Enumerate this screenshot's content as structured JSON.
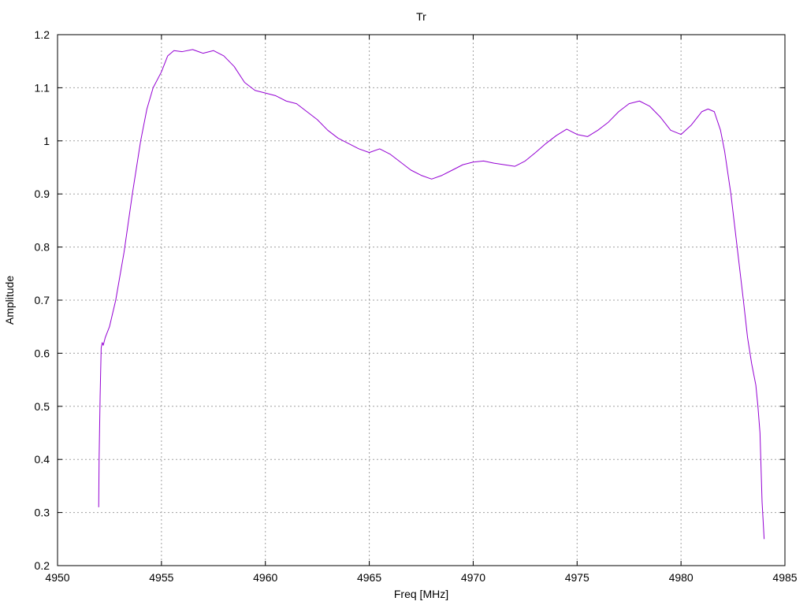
{
  "chart_data": {
    "type": "line",
    "title": "Tr",
    "xlabel": "Freq [MHz]",
    "ylabel": "Amplitude",
    "xlim": [
      4950,
      4985
    ],
    "ylim": [
      0.2,
      1.2
    ],
    "xticks": [
      4950,
      4955,
      4960,
      4965,
      4970,
      4975,
      4980,
      4985
    ],
    "yticks": [
      0.2,
      0.3,
      0.4,
      0.5,
      0.6,
      0.7,
      0.8,
      0.9,
      1,
      1.1,
      1.2
    ],
    "ytick_labels": [
      "0.2",
      "0.3",
      "0.4",
      "0.5",
      "0.6",
      "0.7",
      "0.8",
      "0.9",
      "1",
      "1.1",
      "1.2"
    ],
    "grid": true,
    "series": [
      {
        "color": "#9400d3",
        "x": [
          4951.98,
          4952.0,
          4952.05,
          4952.1,
          4952.15,
          4952.2,
          4952.3,
          4952.5,
          4952.8,
          4953.2,
          4953.6,
          4954.0,
          4954.3,
          4954.6,
          4955.0,
          4955.3,
          4955.6,
          4956.0,
          4956.5,
          4957.0,
          4957.5,
          4958.0,
          4958.5,
          4959.0,
          4959.5,
          4960.0,
          4960.5,
          4961.0,
          4961.5,
          4962.0,
          4962.5,
          4963.0,
          4963.5,
          4964.0,
          4964.5,
          4965.0,
          4965.5,
          4966.0,
          4966.5,
          4967.0,
          4967.5,
          4968.0,
          4968.5,
          4969.0,
          4969.5,
          4970.0,
          4970.5,
          4971.0,
          4971.5,
          4972.0,
          4972.5,
          4973.0,
          4973.5,
          4974.0,
          4974.5,
          4975.0,
          4975.5,
          4976.0,
          4976.5,
          4977.0,
          4977.5,
          4978.0,
          4978.5,
          4979.0,
          4979.5,
          4980.0,
          4980.5,
          4981.0,
          4981.3,
          4981.6,
          4981.9,
          4982.1,
          4982.4,
          4982.7,
          4983.0,
          4983.2,
          4983.4,
          4983.6,
          4983.7,
          4983.8,
          4983.9,
          4984.0
        ],
        "y": [
          0.31,
          0.4,
          0.52,
          0.61,
          0.62,
          0.615,
          0.63,
          0.65,
          0.7,
          0.79,
          0.9,
          1.0,
          1.06,
          1.1,
          1.13,
          1.16,
          1.17,
          1.168,
          1.172,
          1.165,
          1.17,
          1.16,
          1.14,
          1.11,
          1.095,
          1.09,
          1.085,
          1.075,
          1.07,
          1.055,
          1.04,
          1.02,
          1.005,
          0.995,
          0.985,
          0.978,
          0.985,
          0.975,
          0.96,
          0.945,
          0.935,
          0.928,
          0.935,
          0.945,
          0.955,
          0.96,
          0.962,
          0.958,
          0.955,
          0.952,
          0.962,
          0.978,
          0.995,
          1.01,
          1.022,
          1.012,
          1.008,
          1.02,
          1.035,
          1.055,
          1.07,
          1.075,
          1.065,
          1.045,
          1.02,
          1.012,
          1.03,
          1.055,
          1.06,
          1.055,
          1.02,
          0.98,
          0.9,
          0.8,
          0.7,
          0.63,
          0.58,
          0.54,
          0.5,
          0.45,
          0.32,
          0.25
        ]
      }
    ]
  }
}
